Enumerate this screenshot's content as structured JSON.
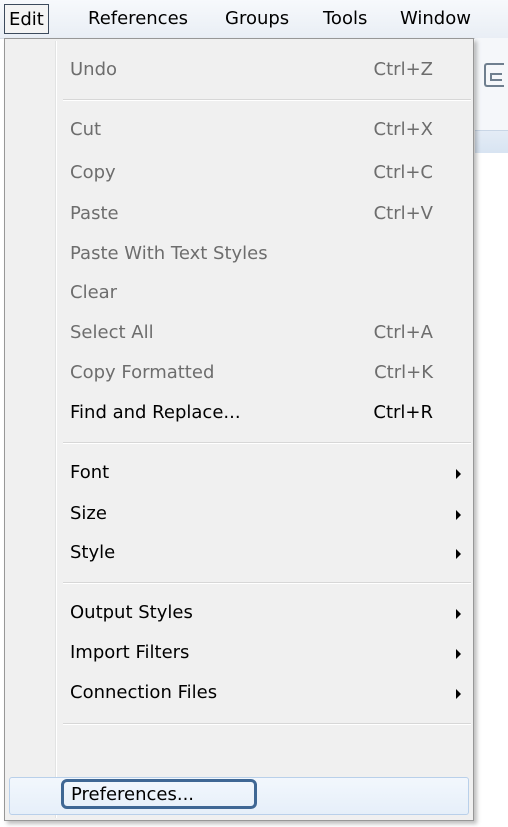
{
  "menubar": {
    "items": [
      {
        "label": "Edit",
        "active": true
      },
      {
        "label": "References",
        "active": false
      },
      {
        "label": "Groups",
        "active": false
      },
      {
        "label": "Tools",
        "active": false
      },
      {
        "label": "Window",
        "active": false
      }
    ]
  },
  "edit_menu": {
    "items": [
      {
        "label": "Undo",
        "shortcut": "Ctrl+Z",
        "enabled": false
      },
      {
        "label": "Cut",
        "shortcut": "Ctrl+X",
        "enabled": false
      },
      {
        "label": "Copy",
        "shortcut": "Ctrl+C",
        "enabled": false
      },
      {
        "label": "Paste",
        "shortcut": "Ctrl+V",
        "enabled": false
      },
      {
        "label": "Paste With Text Styles",
        "shortcut": "",
        "enabled": false
      },
      {
        "label": "Clear",
        "shortcut": "",
        "enabled": false
      },
      {
        "label": "Select All",
        "shortcut": "Ctrl+A",
        "enabled": false
      },
      {
        "label": "Copy Formatted",
        "shortcut": "Ctrl+K",
        "enabled": false
      },
      {
        "label": "Find and Replace...",
        "shortcut": "Ctrl+R",
        "enabled": true
      },
      {
        "label": "Font",
        "submenu": true,
        "enabled": true
      },
      {
        "label": "Size",
        "submenu": true,
        "enabled": true
      },
      {
        "label": "Style",
        "submenu": true,
        "enabled": true
      },
      {
        "label": "Output Styles",
        "submenu": true,
        "enabled": true
      },
      {
        "label": "Import Filters",
        "submenu": true,
        "enabled": true
      },
      {
        "label": "Connection Files",
        "submenu": true,
        "enabled": true
      },
      {
        "label": "Preferences...",
        "enabled": true,
        "highlighted": true
      }
    ]
  },
  "colors": {
    "disabled_text": "#6d6d6d",
    "enabled_text": "#000000",
    "focus_ring": "#3f6794",
    "menu_background": "#f0f0f0"
  }
}
